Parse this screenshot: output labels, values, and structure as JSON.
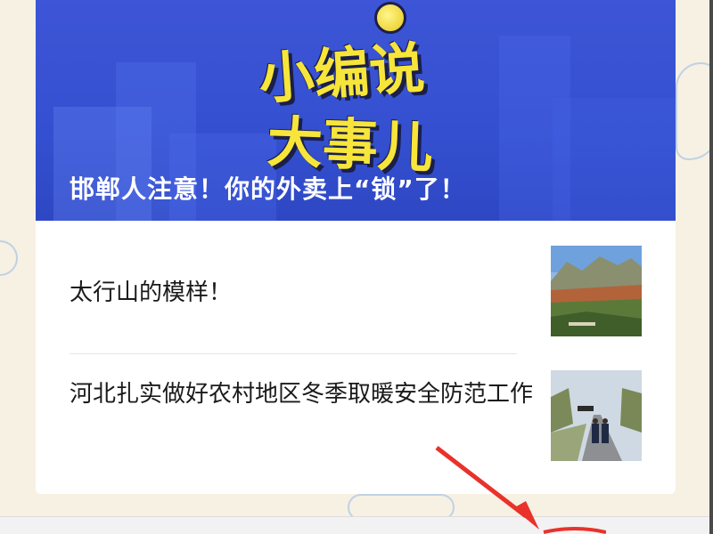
{
  "banner": {
    "logo_line1": "小编说",
    "logo_line2": "大事儿",
    "title": "邯郸人注意！你的外卖上“锁”了！"
  },
  "articles": [
    {
      "title": "太行山的模样！",
      "thumbnail": "mountain-landscape"
    },
    {
      "title": "河北扎实做好农村地区冬季取暖安全防范工作",
      "thumbnail": "road-with-drone-officers"
    }
  ],
  "colors": {
    "banner_bg": "#3450d0",
    "logo_yellow": "#f7e53a",
    "page_bg": "#f6f1e3",
    "arrow_red": "#e8322b"
  }
}
